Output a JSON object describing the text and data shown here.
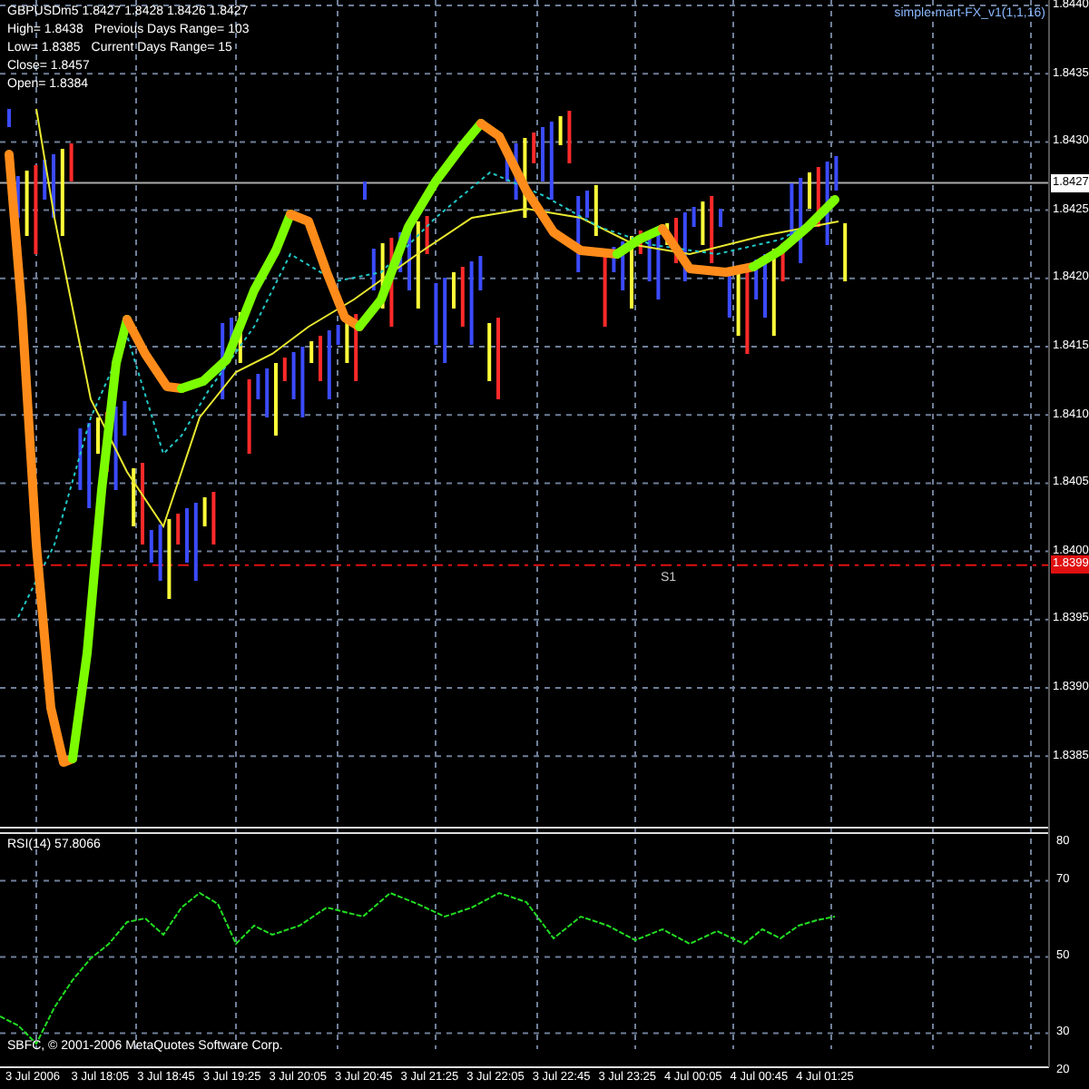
{
  "header": {
    "quote": "GBPUSDm5  1.8427 1.8428 1.8426 1.8427"
  },
  "info_lines": [
    {
      "text": "High= 1.8438",
      "extra": "Previous Days Range= 103"
    },
    {
      "text": "Low= 1.8385",
      "extra": "Current Days Range= 15"
    },
    {
      "text": "Close= 1.8457"
    },
    {
      "text": "Open= 1.8384"
    }
  ],
  "indicator_name": "simple-mart-FX_v1(1,1,16)",
  "pivot_label": "S1",
  "price_axis": {
    "labels": [
      "1.8440",
      "1.8435",
      "1.8430",
      "1.8425",
      "1.8420",
      "1.8415",
      "1.8410",
      "1.8405",
      "1.8400",
      "1.8395",
      "1.8390",
      "1.8385"
    ],
    "current_price": "1.8427",
    "pivot_price": "1.8399"
  },
  "rsi": {
    "title": "RSI(14) 57.8066",
    "axis_labels": [
      "80",
      "70",
      "50",
      "30",
      "20"
    ]
  },
  "copyright": "SBFC, © 2001-2006 MetaQuotes Software Corp.",
  "time_axis": [
    "3 Jul 2006",
    "3 Jul 18:05",
    "3 Jul 18:45",
    "3 Jul 19:25",
    "3 Jul 20:05",
    "3 Jul 20:45",
    "3 Jul 21:25",
    "3 Jul 22:05",
    "3 Jul 22:45",
    "3 Jul 23:25",
    "4 Jul 00:05",
    "4 Jul 00:45",
    "4 Jul 01:25"
  ]
}
